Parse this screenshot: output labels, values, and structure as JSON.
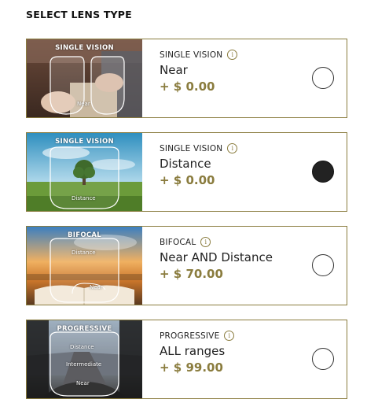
{
  "header": {
    "title": "SELECT LENS TYPE"
  },
  "colors": {
    "accent": "#8a7c3e",
    "selected": "#222222"
  },
  "options": [
    {
      "image_label": "SINGLE VISION",
      "zones": [
        "Near"
      ],
      "category": "SINGLE VISION",
      "name": "Near",
      "price": "+ $ 0.00",
      "selected": false
    },
    {
      "image_label": "SINGLE VISION",
      "zones": [
        "Distance"
      ],
      "category": "SINGLE VISION",
      "name": "Distance",
      "price": "+ $ 0.00",
      "selected": true
    },
    {
      "image_label": "BIFOCAL",
      "zones": [
        "Distance",
        "Near"
      ],
      "category": "BIFOCAL",
      "name": "Near AND Distance",
      "price": "+ $ 70.00",
      "selected": false
    },
    {
      "image_label": "PROGRESSIVE",
      "zones": [
        "Distance",
        "Intermediate",
        "Near"
      ],
      "category": "PROGRESSIVE",
      "name": "ALL ranges",
      "price": "+ $ 99.00",
      "selected": false
    }
  ],
  "icons": {
    "info": "info-icon",
    "lens_outline": "lens-outline-icon"
  },
  "info_glyph": "i"
}
